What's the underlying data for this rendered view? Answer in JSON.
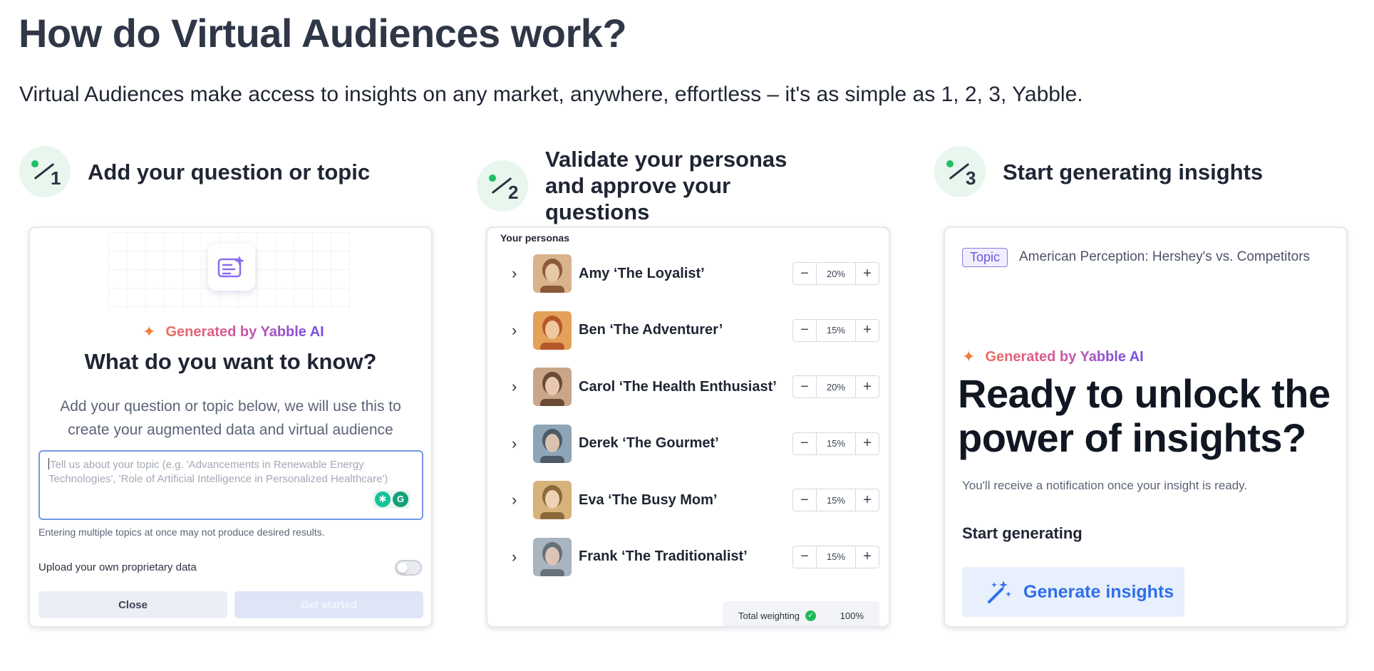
{
  "page": {
    "title": "How do Virtual Audiences work?",
    "subtitle": "Virtual Audiences make access to insights on any market, anywhere, effortless – it's as simple as 1, 2, 3, Yabble."
  },
  "steps": [
    {
      "number": "1",
      "title": "Add your question or topic"
    },
    {
      "number": "2",
      "title": "Validate your personas and approve your questions"
    },
    {
      "number": "3",
      "title": "Start generating insights"
    }
  ],
  "card1": {
    "icon": "document-sparkle-icon",
    "generated_label": "Generated by Yabble AI",
    "heading": "What do you want to know?",
    "description": "Add your question or topic below, we will use this to create your augmented data and virtual audience",
    "input_placeholder": "Tell us about your topic (e.g. 'Advancements in Renewable Energy Technologies', 'Role of Artificial Intelligence in Personalized Healthcare')",
    "grammarly_g": "G",
    "hint": "Entering multiple topics at once may not produce desired results.",
    "upload_label": "Upload your own proprietary data",
    "upload_enabled": false,
    "close_label": "Close",
    "start_label": "Get started"
  },
  "card2": {
    "title": "Your personas",
    "personas": [
      {
        "name": "Amy ‘The Loyalist’",
        "weight": "20%",
        "weight_value": 20
      },
      {
        "name": "Ben ‘The Adventurer’",
        "weight": "15%",
        "weight_value": 15
      },
      {
        "name": "Carol ‘The Health Enthusiast’",
        "weight": "20%",
        "weight_value": 20
      },
      {
        "name": "Derek ‘The Gourmet’",
        "weight": "15%",
        "weight_value": 15
      },
      {
        "name": "Eva ‘The Busy Mom’",
        "weight": "15%",
        "weight_value": 15
      },
      {
        "name": "Frank ‘The Traditionalist’",
        "weight": "15%",
        "weight_value": 15
      }
    ],
    "total_label": "Total weighting",
    "total_value": "100%"
  },
  "card3": {
    "topic_badge": "Topic",
    "topic_text": "American Perception: Hershey's vs. Competitors",
    "generated_label": "Generated by Yabble AI",
    "heading_line1": "Ready to unlock the",
    "heading_line2": "power of insights?",
    "note": "You'll receive a notification once your insight is ready.",
    "start_label": "Start generating",
    "button_label": "Generate insights"
  },
  "colors": {
    "accent_green": "#1fbf63",
    "button_blue": "#2f6fe8",
    "topic_purple": "#6a55d8"
  }
}
